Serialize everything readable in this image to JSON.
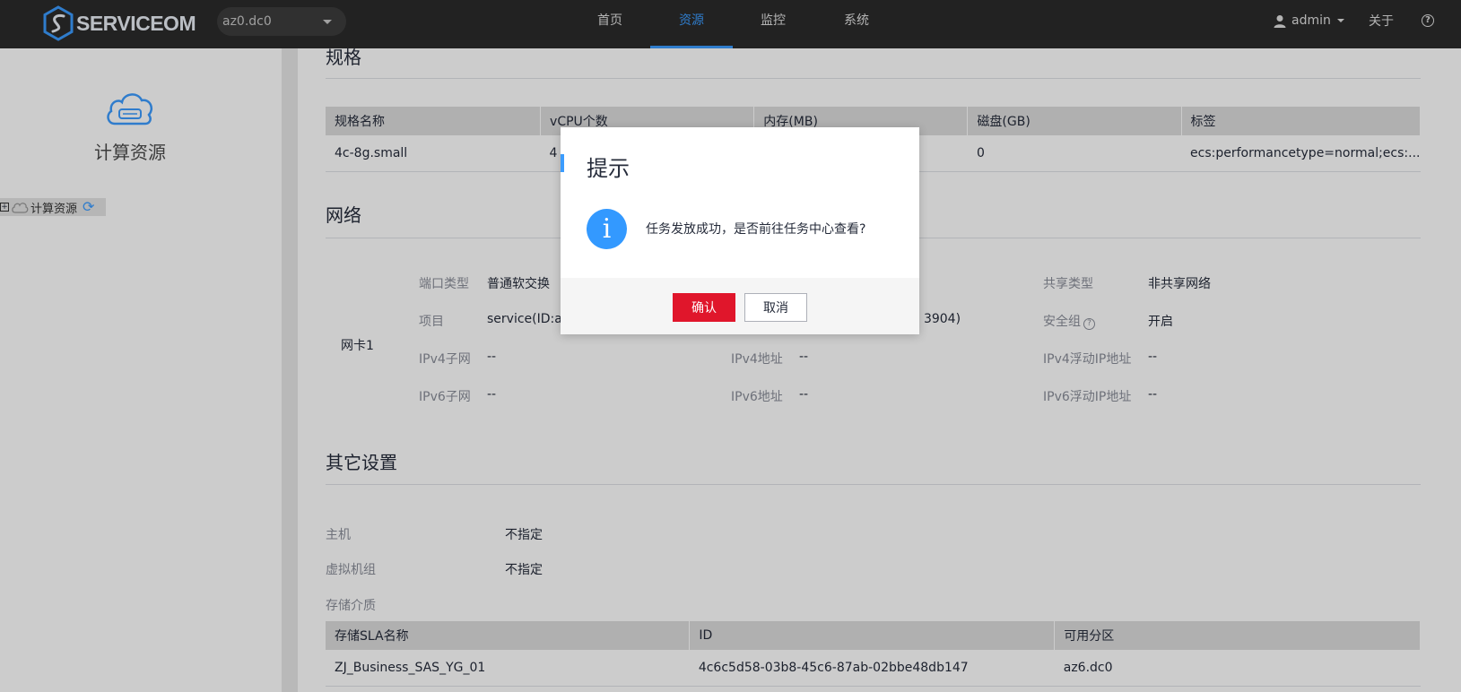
{
  "header": {
    "logo_text": "SERVICEOM",
    "az_select_value": "az0.dc0",
    "nav": [
      {
        "label": "首页",
        "active": false
      },
      {
        "label": "资源",
        "active": true
      },
      {
        "label": "监控",
        "active": false
      },
      {
        "label": "系统",
        "active": false
      }
    ],
    "user_name": "admin",
    "about_label": "关于",
    "accent_color": "#3b9cff"
  },
  "sidebar": {
    "title": "计算资源",
    "tree": {
      "toggle": "⊞",
      "label": "计算资源",
      "refresh_icon": "⟳"
    }
  },
  "spec_section": {
    "title": "规格",
    "columns": [
      "规格名称",
      "vCPU个数",
      "内存(MB)",
      "磁盘(GB)",
      "标签"
    ],
    "rows": [
      [
        "4c-8g.small",
        "4",
        "",
        "0",
        "ecs:performancetype=normal;ecs:..."
      ]
    ]
  },
  "network_section": {
    "title": "网络",
    "nic_label": "网卡1",
    "fields": {
      "port_type_key": "端口类型",
      "port_type_value": "普通软交换",
      "share_type_key": "共享类型",
      "share_type_value": "非共享网络",
      "project_key": "项目",
      "project_value": "service(ID:ac",
      "project_extra": "D: 3904)",
      "security_group_key": "安全组",
      "security_group_value": "开启",
      "ipv4_subnet_key": "IPv4子网",
      "ipv4_subnet_value": "--",
      "ipv4_addr_key": "IPv4地址",
      "ipv4_addr_value": "--",
      "ipv4_float_key": "IPv4浮动IP地址",
      "ipv4_float_value": "--",
      "ipv6_subnet_key": "IPv6子网",
      "ipv6_subnet_value": "--",
      "ipv6_addr_key": "IPv6地址",
      "ipv6_addr_value": "--",
      "ipv6_float_key": "IPv6浮动IP地址",
      "ipv6_float_value": "--"
    }
  },
  "other_section": {
    "title": "其它设置",
    "host_key": "主机",
    "host_value": "不指定",
    "vm_group_key": "虚拟机组",
    "vm_group_value": "不指定",
    "storage_key": "存储介质",
    "storage_columns": [
      "存储SLA名称",
      "ID",
      "可用分区"
    ],
    "storage_rows": [
      [
        "ZJ_Business_SAS_YG_01",
        "4c6c5d58-03b8-45c6-87ab-02bbe48db147",
        "az6.dc0"
      ]
    ]
  },
  "modal": {
    "title": "提示",
    "icon_glyph": "i",
    "message": "任务发放成功，是否前往任务中心查看?",
    "confirm_label": "确认",
    "cancel_label": "取消",
    "confirm_color": "#e0162b"
  }
}
